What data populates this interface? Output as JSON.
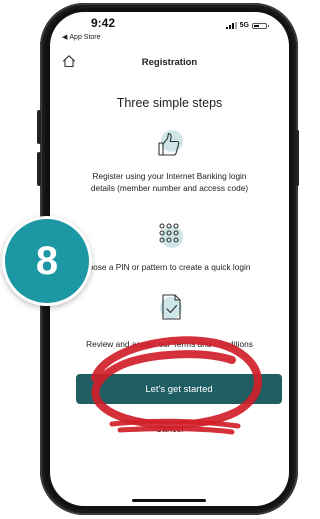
{
  "status_bar": {
    "time": "9:42",
    "back_to_app": "App Store",
    "network": "5G",
    "battery_level": 0.45
  },
  "nav": {
    "title": "Registration"
  },
  "main": {
    "heading": "Three simple steps",
    "steps": [
      {
        "icon": "thumbs-up-icon",
        "line1": "Register using your Internet Banking login",
        "line2": "details (member number and access code)"
      },
      {
        "icon": "keypad-dots-icon",
        "line1": "oose a PIN or pattern to create a quick login",
        "line2": ""
      },
      {
        "icon": "document-check-icon",
        "line1": "Review and accept our Terms and Conditions",
        "line2": ""
      }
    ],
    "primary_button": "Let's get started",
    "cancel_link": "Cancel"
  },
  "annotation": {
    "step_number": "8"
  },
  "colors": {
    "primary": "#1f5e63",
    "icon_bg": "#cfe6e9",
    "badge": "#1c97a4",
    "annotation_ink": "#d0202a"
  }
}
